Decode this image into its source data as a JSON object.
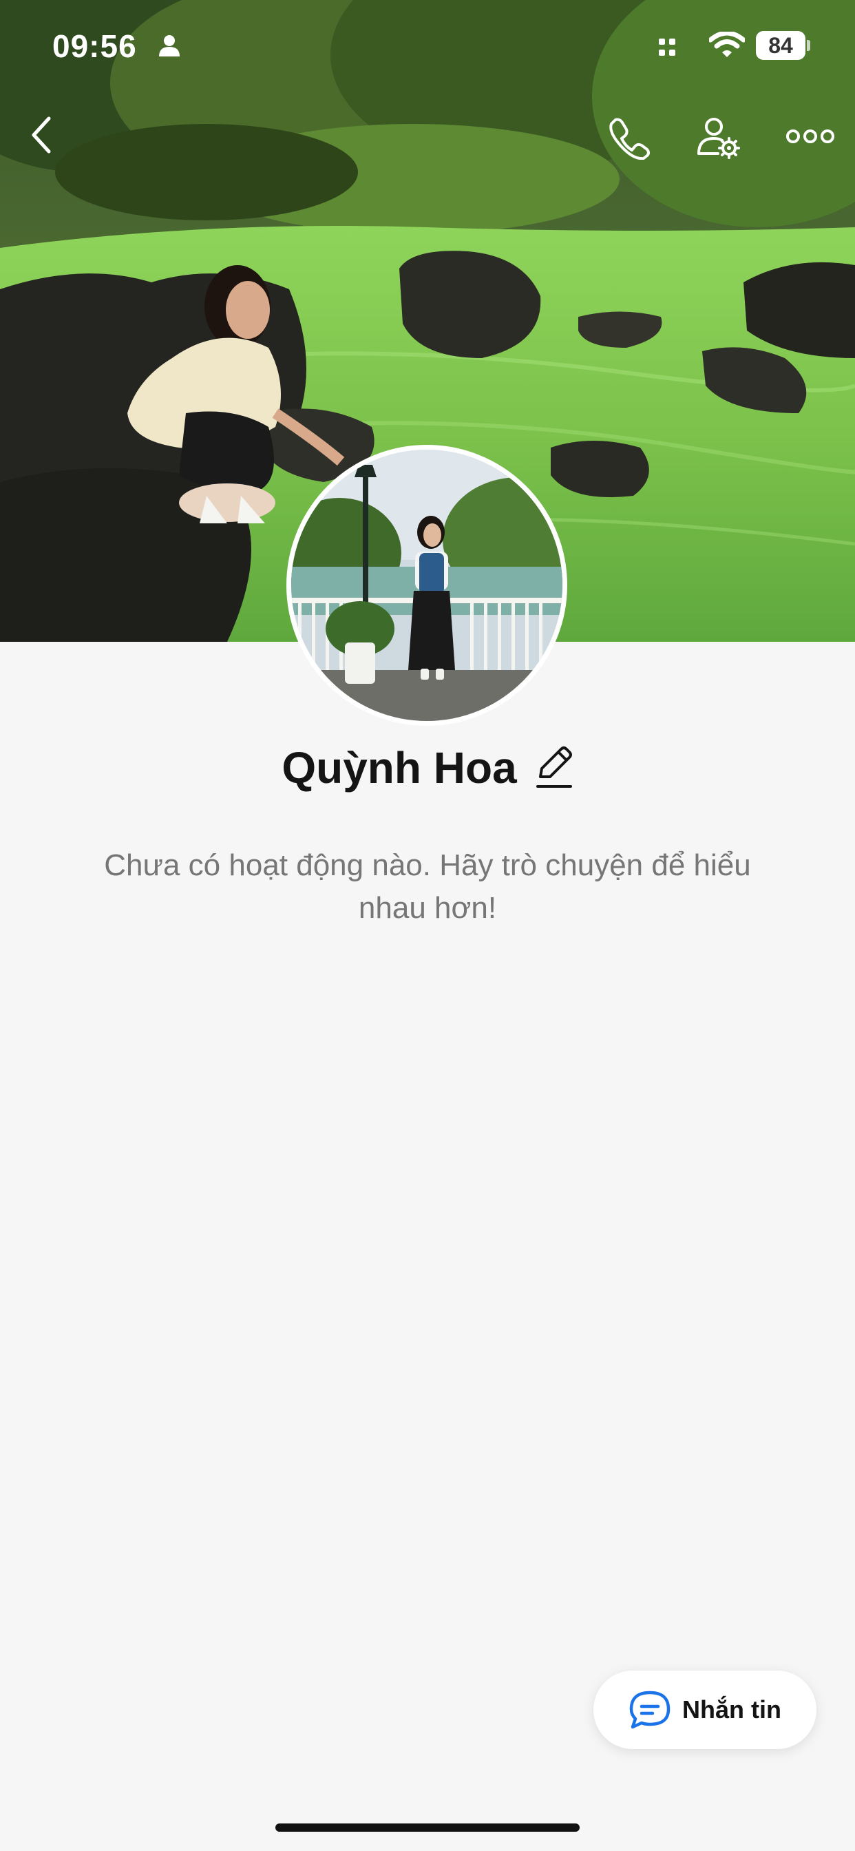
{
  "status_bar": {
    "time": "09:56",
    "battery_level": "84",
    "icons": [
      "person-icon",
      "signal-icon",
      "wifi-icon",
      "battery-icon"
    ]
  },
  "header": {
    "icons": [
      "back-chevron-icon",
      "phone-icon",
      "user-settings-icon",
      "more-dots-icon"
    ]
  },
  "profile": {
    "name": "Quỳnh Hoa",
    "empty_message": "Chưa có hoạt động nào. Hãy trò chuyện để hiểu nhau hơn!"
  },
  "message_button": {
    "label": "Nhắn tin",
    "icon": "chat-bubble-icon",
    "icon_color": "#1a73e8"
  },
  "colors": {
    "background": "#f6f6f6",
    "water": "#7fc74a",
    "accent_blue": "#1a73e8"
  }
}
